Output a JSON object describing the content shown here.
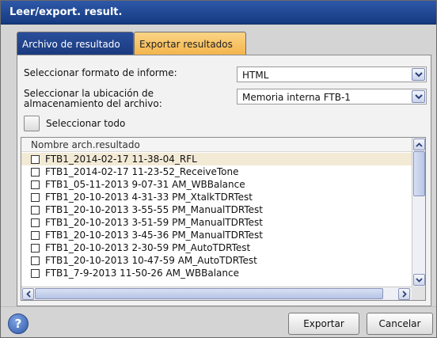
{
  "window": {
    "title": "Leer/export. result."
  },
  "tabs": [
    {
      "label": "Archivo de resultado"
    },
    {
      "label": "Exportar resultados"
    }
  ],
  "report_format": {
    "label": "Seleccionar formato de informe:",
    "value": "HTML"
  },
  "storage_location": {
    "label_line1": "Seleccionar la ubicación de",
    "label_line2": "almacenamiento del archivo:",
    "value": "Memoria interna FTB-1"
  },
  "select_all": {
    "label": "Seleccionar todo"
  },
  "file_list": {
    "header": "Nombre arch.resultado",
    "items": [
      "FTB1_2014-02-17 11-38-04_RFL",
      "FTB1_2014-02-17 11-23-52_ReceiveTone",
      "FTB1_05-11-2013 9-07-31 AM_WBBalance",
      "FTB1_20-10-2013 4-31-33 PM_XtalkTDRTest",
      "FTB1_20-10-2013 3-55-55 PM_ManualTDRTest",
      "FTB1_20-10-2013 3-51-59 PM_ManualTDRTest",
      "FTB1_20-10-2013 3-45-36 PM_ManualTDRTest",
      "FTB1_20-10-2013 2-30-59 PM_AutoTDRTest",
      "FTB1_20-10-2013 10-47-59 AM_AutoTDRTest",
      "FTB1_7-9-2013 11-50-26 AM_WBBalance"
    ]
  },
  "buttons": {
    "help": "?",
    "export": "Exportar",
    "cancel": "Cancelar"
  }
}
